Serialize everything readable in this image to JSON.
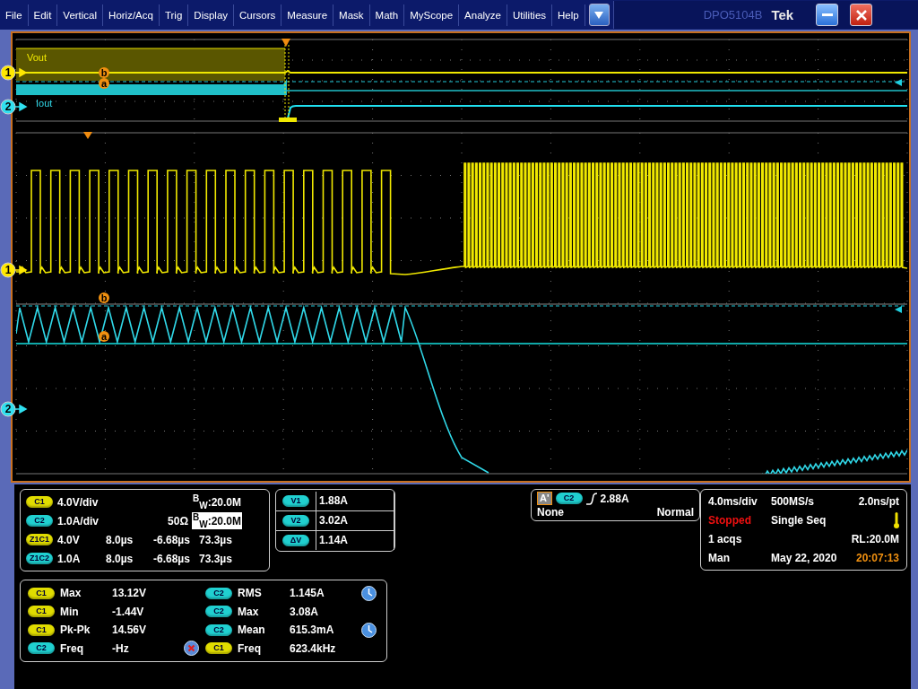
{
  "menu_bar": {
    "items": [
      "File",
      "Edit",
      "Vertical",
      "Horiz/Acq",
      "Trig",
      "Display",
      "Cursors",
      "Measure",
      "Mask",
      "Math",
      "MyScope",
      "Analyze",
      "Utilities",
      "Help"
    ],
    "model": "DPO5104B",
    "brand": "Tek"
  },
  "display": {
    "overview": {
      "labels": [
        "Vout",
        "Iout"
      ],
      "channel_markers": [
        "1",
        "2"
      ],
      "cursor_markers": [
        "b",
        "a"
      ]
    },
    "main": {
      "channel_markers": [
        "1",
        "2"
      ],
      "cursor_markers": [
        "b",
        "a"
      ]
    }
  },
  "channels": [
    {
      "kind": "channel",
      "badge": {
        "label": "C1",
        "color": "#e0dc00"
      },
      "scale": "4.0V/div",
      "bandwidth": "$^{B}$$_{W}$:20.0M",
      "bandwidth_highlighted": false
    },
    {
      "kind": "channel",
      "badge": {
        "label": "C2",
        "color": "#20d0d0"
      },
      "scale": "1.0A/div",
      "termination": "50Ω",
      "bandwidth": "$^{B}$$_{W}$:20.0M",
      "bandwidth_highlighted": true
    },
    {
      "kind": "zoom",
      "badge": {
        "label": "Z1C1",
        "color": "#e0dc00"
      },
      "scale": "4.0V",
      "position": "8.0µs",
      "offset": "-6.68µs",
      "width": "73.3µs"
    },
    {
      "kind": "zoom",
      "badge": {
        "label": "Z1C2",
        "color": "#20d0d0"
      },
      "scale": "1.0A",
      "position": "8.0µs",
      "offset": "-6.68µs",
      "width": "73.3µs"
    }
  ],
  "cursors": [
    {
      "badge": {
        "label": "V1",
        "color": "#20d0d0"
      },
      "value": "1.88A"
    },
    {
      "badge": {
        "label": "V2",
        "color": "#20d0d0"
      },
      "value": "3.02A"
    },
    {
      "badge": {
        "label": "ΔV",
        "color": "#20d0d0"
      },
      "value": "1.14A"
    }
  ],
  "trigger": {
    "mode_label": "A'",
    "badge": {
      "label": "C2",
      "color": "#20d0d0"
    },
    "level": "2.88A",
    "coupling": "None",
    "mode": "Normal"
  },
  "acquisition": {
    "time_scale": "4.0ms/div",
    "sample_rate": "500MS/s",
    "resolution": "2.0ns/pt",
    "state": "Stopped",
    "run_mode": "Single Seq",
    "count": "1 acqs",
    "record_length": "RL:20.0M",
    "trigger_mode": "Man",
    "date": "May 22, 2020",
    "time": "20:07:13"
  },
  "measurements": [
    {
      "badge": {
        "label": "C1",
        "color": "#e0dc00"
      },
      "name": "Max",
      "value": "13.12V",
      "kind": "plain"
    },
    {
      "badge": {
        "label": "C1",
        "color": "#e0dc00"
      },
      "name": "Min",
      "value": "-1.44V",
      "kind": "plain"
    },
    {
      "badge": {
        "label": "C1",
        "color": "#e0dc00"
      },
      "name": "Pk-Pk",
      "value": "14.56V",
      "kind": "plain"
    },
    {
      "badge": {
        "label": "C2",
        "color": "#20d0d0"
      },
      "name": "Freq",
      "value": "-Hz",
      "kind": "error"
    },
    {
      "badge": {
        "label": "C2",
        "color": "#20d0d0"
      },
      "name": "RMS",
      "value": "1.145A",
      "kind": "timed"
    },
    {
      "badge": {
        "label": "C2",
        "color": "#20d0d0"
      },
      "name": "Max",
      "value": "3.08A",
      "kind": "plain"
    },
    {
      "badge": {
        "label": "C2",
        "color": "#20d0d0"
      },
      "name": "Mean",
      "value": "615.3mA",
      "kind": "timed"
    },
    {
      "badge": {
        "label": "C1",
        "color": "#e0dc00"
      },
      "name": "Freq",
      "value": "623.4kHz",
      "kind": "plain"
    }
  ]
}
